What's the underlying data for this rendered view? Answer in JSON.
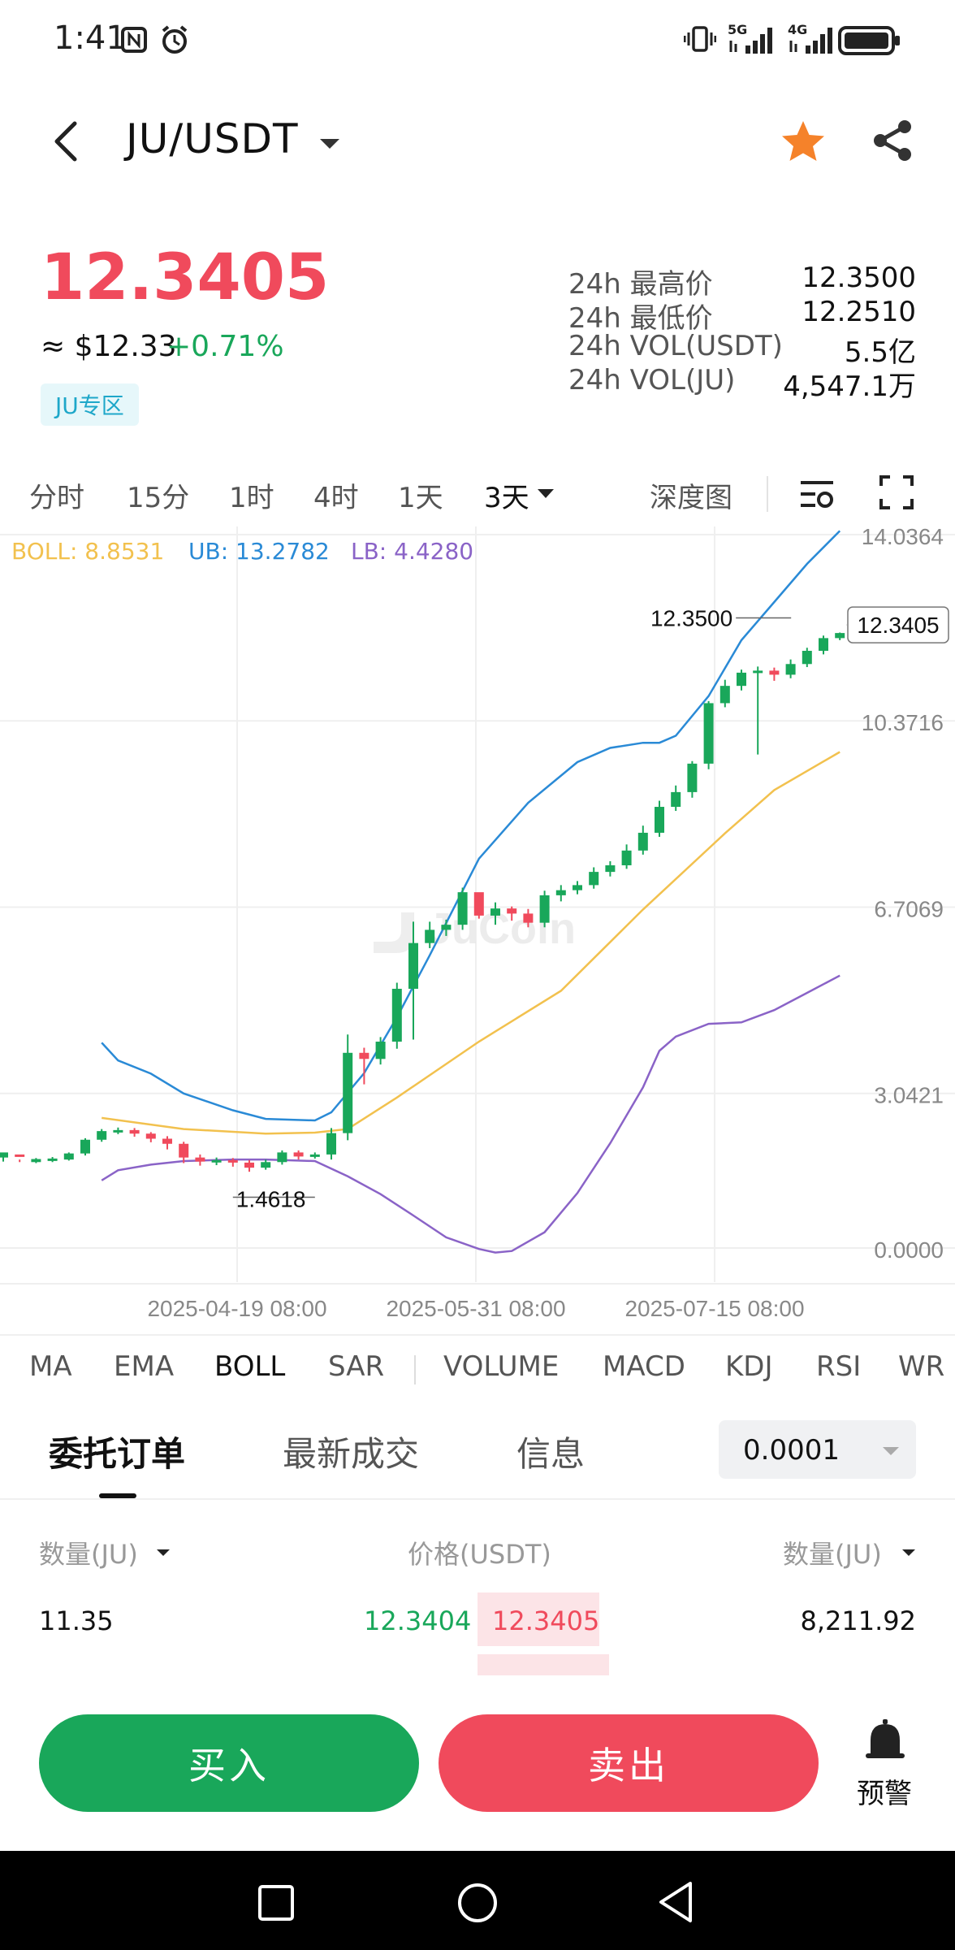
{
  "status_bar": {
    "time": "1:41",
    "network_5g": "5G",
    "network_4g": "4G"
  },
  "header": {
    "pair": "JU/USDT",
    "icons": [
      "back-arrow-icon",
      "dropdown-caret-icon",
      "star-icon",
      "share-icon"
    ],
    "star_color": "#F5822A"
  },
  "ticker": {
    "last_price": "12.3405",
    "fiat_value": "≈ $12.33",
    "change": "+0.71%",
    "zone_tag": "JU专区",
    "stats": [
      {
        "label": "24h 最高价",
        "value": "12.3500"
      },
      {
        "label": "24h 最低价",
        "value": "12.2510"
      },
      {
        "label": "24h VOL(USDT)",
        "value": "5.5亿"
      },
      {
        "label": "24h VOL(JU)",
        "value": "4,547.1万"
      }
    ]
  },
  "intervals": {
    "items": [
      "分时",
      "15分",
      "1时",
      "4时",
      "1天",
      "3天"
    ],
    "selected": "3天",
    "depth_label": "深度图"
  },
  "chart_data": {
    "type": "candlestick",
    "indicator_legend": {
      "boll": "BOLL: 8.8531",
      "ub": "UB: 13.2782",
      "lb": "LB: 4.4280"
    },
    "colors": {
      "up": "#19A75A",
      "down": "#F04A5C",
      "mid": "#F2C14E",
      "ub": "#2A8AD6",
      "lb": "#8A63C7"
    },
    "y_ticks": [
      "14.0364",
      "10.3716",
      "6.7069",
      "3.0421",
      "0.0000"
    ],
    "ylim": [
      0,
      14.0364
    ],
    "x_ticks": [
      "2025-04-19 08:00",
      "2025-05-31 08:00",
      "2025-07-15 08:00"
    ],
    "high_label": "12.3500",
    "low_label": "1.4618",
    "last_label": "12.3405",
    "watermark": "JuCoin",
    "candles": [
      [
        2.02,
        2.12,
        1.94,
        2.08
      ],
      [
        2.08,
        2.05,
        1.98,
        1.93
      ],
      [
        1.93,
        1.99,
        1.91,
        2.01
      ],
      [
        1.98,
        2.0,
        1.93,
        2.03
      ],
      [
        1.98,
        2.1,
        1.96,
        2.12
      ],
      [
        2.1,
        2.37,
        2.06,
        2.4
      ],
      [
        2.37,
        2.54,
        2.33,
        2.58
      ],
      [
        2.54,
        2.56,
        2.48,
        2.61
      ],
      [
        2.56,
        2.49,
        2.43,
        2.6
      ],
      [
        2.49,
        2.39,
        2.32,
        2.52
      ],
      [
        2.39,
        2.29,
        2.18,
        2.44
      ],
      [
        2.29,
        2.02,
        1.91,
        2.33
      ],
      [
        2.02,
        1.94,
        1.86,
        2.08
      ],
      [
        1.94,
        1.97,
        1.87,
        2.02
      ],
      [
        1.97,
        1.92,
        1.84,
        2.01
      ],
      [
        1.92,
        1.82,
        1.74,
        1.97
      ],
      [
        1.82,
        1.93,
        1.78,
        1.98
      ],
      [
        1.93,
        2.12,
        1.88,
        2.16
      ],
      [
        2.12,
        2.04,
        1.98,
        2.16
      ],
      [
        2.04,
        2.08,
        2.0,
        2.12
      ],
      [
        2.08,
        2.5,
        1.98,
        2.6
      ],
      [
        2.5,
        4.08,
        2.36,
        4.44
      ],
      [
        4.08,
        3.96,
        3.46,
        4.18
      ],
      [
        3.96,
        4.3,
        3.85,
        4.39
      ],
      [
        4.3,
        5.34,
        4.16,
        5.46
      ],
      [
        5.34,
        6.24,
        4.34,
        6.66
      ],
      [
        6.24,
        6.5,
        6.14,
        6.66
      ],
      [
        6.5,
        6.6,
        6.38,
        6.7
      ],
      [
        6.6,
        7.24,
        6.5,
        7.33
      ],
      [
        7.24,
        6.78,
        6.72,
        7.2
      ],
      [
        6.78,
        6.92,
        6.6,
        7.04
      ],
      [
        6.92,
        6.82,
        6.68,
        6.96
      ],
      [
        6.82,
        6.64,
        6.55,
        6.91
      ],
      [
        6.64,
        7.18,
        6.55,
        7.27
      ],
      [
        7.18,
        7.28,
        7.06,
        7.38
      ],
      [
        7.28,
        7.38,
        7.2,
        7.46
      ],
      [
        7.38,
        7.64,
        7.31,
        7.73
      ],
      [
        7.64,
        7.77,
        7.55,
        7.85
      ],
      [
        7.77,
        8.06,
        7.7,
        8.18
      ],
      [
        8.06,
        8.41,
        7.98,
        8.55
      ],
      [
        8.41,
        8.92,
        8.33,
        9.04
      ],
      [
        8.92,
        9.21,
        8.84,
        9.34
      ],
      [
        9.21,
        9.77,
        9.1,
        9.82
      ],
      [
        9.77,
        10.96,
        9.66,
        11.0
      ],
      [
        10.96,
        11.3,
        10.88,
        11.42
      ],
      [
        11.3,
        11.56,
        11.21,
        11.62
      ],
      [
        11.56,
        11.6,
        9.95,
        11.68
      ],
      [
        11.6,
        11.52,
        11.4,
        11.66
      ],
      [
        11.52,
        11.73,
        11.45,
        11.82
      ],
      [
        11.73,
        11.99,
        11.67,
        12.05
      ],
      [
        11.99,
        12.24,
        11.92,
        12.29
      ],
      [
        12.24,
        12.34,
        12.2,
        12.35
      ]
    ],
    "middle_band_points": [
      [
        6,
        2.8
      ],
      [
        11,
        2.58
      ],
      [
        16,
        2.49
      ],
      [
        19,
        2.51
      ],
      [
        21,
        2.58
      ],
      [
        24,
        3.2
      ],
      [
        29,
        4.3
      ],
      [
        34,
        5.3
      ],
      [
        39,
        6.9
      ],
      [
        44,
        8.4
      ],
      [
        47,
        9.25
      ],
      [
        51,
        10.0
      ]
    ],
    "upper_band_points": [
      [
        6,
        4.28
      ],
      [
        7,
        3.93
      ],
      [
        9,
        3.67
      ],
      [
        11,
        3.28
      ],
      [
        14,
        2.95
      ],
      [
        16,
        2.78
      ],
      [
        19,
        2.75
      ],
      [
        20,
        2.91
      ],
      [
        22,
        3.68
      ],
      [
        24,
        4.78
      ],
      [
        26,
        6.0
      ],
      [
        29,
        7.9
      ],
      [
        32,
        9.0
      ],
      [
        35,
        9.8
      ],
      [
        37,
        10.08
      ],
      [
        39,
        10.18
      ],
      [
        40,
        10.18
      ],
      [
        41,
        10.32
      ],
      [
        43,
        11.1
      ],
      [
        45,
        12.2
      ],
      [
        47,
        12.95
      ],
      [
        49,
        13.7
      ],
      [
        51,
        14.35
      ]
    ],
    "lower_band_points": [
      [
        6,
        1.57
      ],
      [
        7,
        1.77
      ],
      [
        9,
        1.88
      ],
      [
        11,
        1.95
      ],
      [
        14,
        1.98
      ],
      [
        16,
        1.98
      ],
      [
        19,
        1.95
      ],
      [
        21,
        1.65
      ],
      [
        23,
        1.3
      ],
      [
        25,
        0.88
      ],
      [
        27,
        0.45
      ],
      [
        29,
        0.22
      ],
      [
        30,
        0.15
      ],
      [
        31,
        0.18
      ],
      [
        33,
        0.55
      ],
      [
        35,
        1.32
      ],
      [
        37,
        2.3
      ],
      [
        39,
        3.4
      ],
      [
        40,
        4.12
      ],
      [
        41,
        4.4
      ],
      [
        43,
        4.65
      ],
      [
        45,
        4.68
      ],
      [
        47,
        4.92
      ],
      [
        49,
        5.26
      ],
      [
        51,
        5.6
      ]
    ]
  },
  "indicators": {
    "items": [
      "MA",
      "EMA",
      "BOLL",
      "SAR",
      "VOLUME",
      "MACD",
      "KDJ",
      "RSI",
      "WR"
    ],
    "selected": "BOLL"
  },
  "order_tabs": {
    "items": [
      "委托订单",
      "最新成交",
      "信息"
    ],
    "selected": "委托订单",
    "precision": "0.0001"
  },
  "order_book": {
    "col_qty_left": "数量(JU)",
    "col_price": "价格(USDT)",
    "col_qty_right": "数量(JU)",
    "rows": [
      {
        "bid_qty": "11.35",
        "bid_price": "12.3404",
        "ask_price": "12.3405",
        "ask_qty": "8,211.92"
      }
    ]
  },
  "actions": {
    "buy": "买入",
    "sell": "卖出",
    "alert": "预警"
  }
}
